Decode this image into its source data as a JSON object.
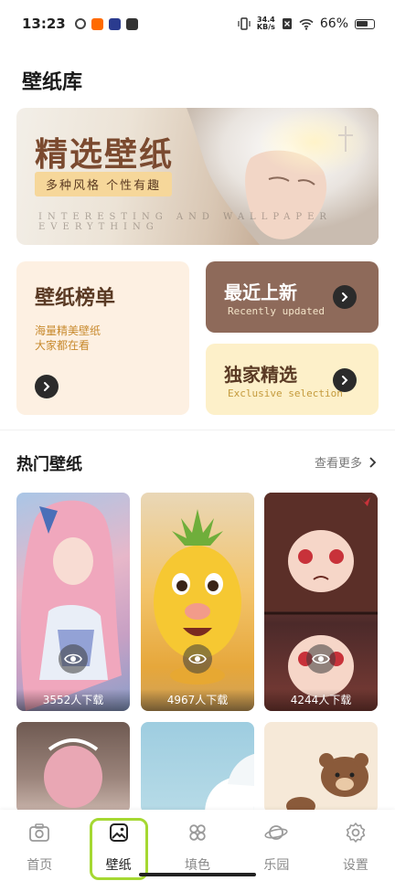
{
  "status_bar": {
    "time": "13:23",
    "net_speed_value": "34.4",
    "net_speed_unit": "KB/s",
    "battery": "66%"
  },
  "page": {
    "title": "壁纸库"
  },
  "banner": {
    "title": "精选壁纸",
    "subtitle": "多种风格 个性有趣",
    "watermark": "INTERESTING AND WALLPAPER EVERYTHING"
  },
  "cards": {
    "rank": {
      "title": "壁纸榜单",
      "desc_line1": "海量精美壁纸",
      "desc_line2": "大家都在看"
    },
    "new": {
      "title": "最近上新",
      "subtitle": "Recently updated"
    },
    "exclusive": {
      "title": "独家精选",
      "subtitle": "Exclusive selection"
    }
  },
  "hot_section": {
    "title": "热门壁纸",
    "see_more": "查看更多",
    "items": [
      {
        "downloads": "3552人下载"
      },
      {
        "downloads": "4967人下载"
      },
      {
        "downloads": "4244人下载"
      }
    ]
  },
  "bottom_nav": {
    "items": [
      {
        "label": "首页",
        "icon": "camera-icon"
      },
      {
        "label": "壁纸",
        "icon": "image-icon"
      },
      {
        "label": "填色",
        "icon": "palette-icon"
      },
      {
        "label": "乐园",
        "icon": "planet-icon"
      },
      {
        "label": "设置",
        "icon": "gear-icon"
      }
    ],
    "active_index": 1
  },
  "colors": {
    "highlight": "#a5d832",
    "card_new_bg": "#8e6a5a",
    "card_rank_bg": "#fdf0e2",
    "card_excl_bg": "#fdf0c9"
  }
}
